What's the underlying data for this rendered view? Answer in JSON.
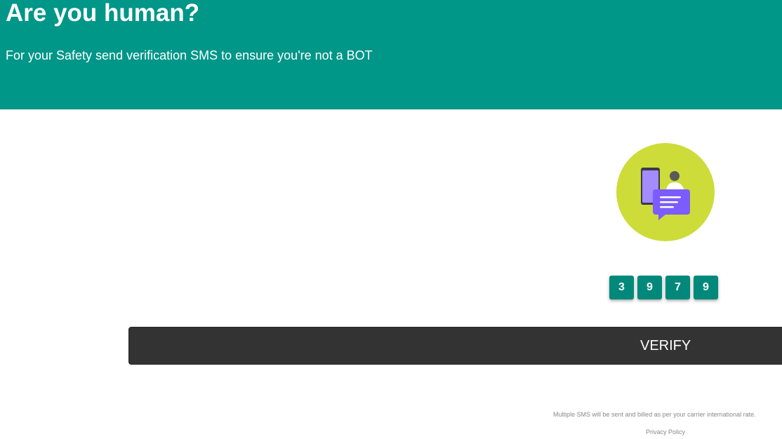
{
  "header": {
    "title": "Are you human?",
    "subtitle": "For your Safety send verification SMS to ensure you're not a BOT"
  },
  "illustration": {
    "icon": "phone-sms-chat-icon"
  },
  "code": {
    "digits": [
      "3",
      "9",
      "7",
      "9"
    ]
  },
  "verify_button": {
    "label": "VERIFY"
  },
  "footer": {
    "disclaimer": "Multiple SMS will be sent and billed as per your carrier international rate.",
    "privacy_link": "Privacy Policy"
  },
  "colors": {
    "header_bg": "#009688",
    "digit_bg": "#00897b",
    "button_bg": "#333333",
    "illustration_circle": "#cddc39",
    "illustration_bubble": "#7c5cff"
  }
}
